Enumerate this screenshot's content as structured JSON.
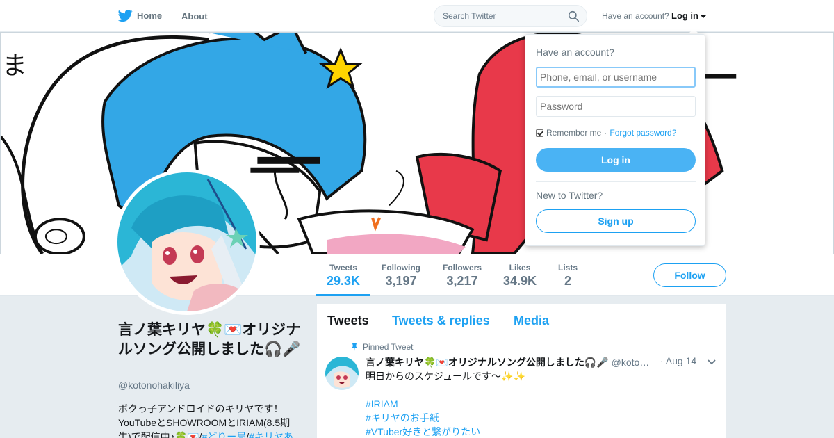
{
  "nav": {
    "home_label": "Home",
    "about_label": "About",
    "search_placeholder": "Search Twitter",
    "have_account_text": "Have an account?",
    "login_label": "Log in"
  },
  "login_dropdown": {
    "title": "Have an account?",
    "username_placeholder": "Phone, email, or username",
    "password_placeholder": "Password",
    "remember_label": "Remember me",
    "separator": "·",
    "forgot_label": "Forgot password?",
    "login_button": "Log in",
    "new_text": "New to Twitter?",
    "signup_button": "Sign up"
  },
  "stats": [
    {
      "label": "Tweets",
      "value": "29.3K"
    },
    {
      "label": "Following",
      "value": "3,197"
    },
    {
      "label": "Followers",
      "value": "3,217"
    },
    {
      "label": "Likes",
      "value": "34.9K"
    },
    {
      "label": "Lists",
      "value": "2"
    }
  ],
  "follow_label": "Follow",
  "profile": {
    "name": "言ノ葉キリヤ🍀💌オリジナルソング公開しました🎧🎤",
    "handle": "@kotonohakiliya",
    "bio_line1": "ボクっ子アンドロイドのキリヤです！",
    "bio_line2": "YouTubeとSHOWROOMとIRIAM(8.5期",
    "bio_line3_prefix": "生)で配信中♪🍀💌/",
    "bio_tag1": "#どりー局",
    "bio_sep": "/",
    "bio_tag2": "#キリヤあ"
  },
  "timeline": {
    "tabs": [
      "Tweets",
      "Tweets & replies",
      "Media"
    ],
    "pinned_label": "Pinned Tweet",
    "tweet": {
      "name": "言ノ葉キリヤ🍀💌オリジナルソング公開しました🎧🎤",
      "handle": "@koto…",
      "date": "· Aug 14",
      "text": "明日からのスケジュールです～✨✨",
      "hashtags": [
        "#IRIAM",
        "#キリヤのお手紙",
        "#VTuber好きと繋がりたい"
      ]
    }
  },
  "colors": {
    "accent": "#1da1f2",
    "background": "#e6ecf0",
    "login_button": "#4ab3f4"
  }
}
